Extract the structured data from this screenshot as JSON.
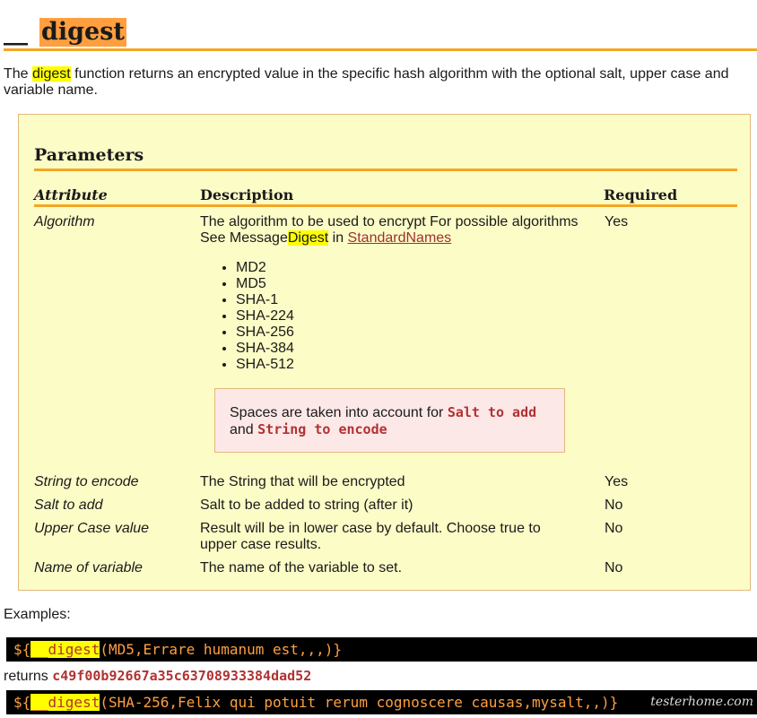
{
  "title": {
    "prefix": "__",
    "name": "digest"
  },
  "intro": {
    "before": "The ",
    "highlight": "digest",
    "after": " function returns an encrypted value in the specific hash algorithm with the optional salt, upper case and variable name."
  },
  "parameters": {
    "heading": "Parameters",
    "columns": {
      "attribute": "Attribute",
      "description": "Description",
      "required": "Required"
    },
    "rows": [
      {
        "attribute": "Algorithm",
        "desc_line1": "The algorithm to be used to encrypt For possible algorithms",
        "desc_line2_before": "See Message",
        "desc_line2_highlight": "Digest",
        "desc_line2_mid": " in ",
        "desc_link": "StandardNames",
        "algorithms": [
          "MD2",
          "MD5",
          "SHA-1",
          "SHA-224",
          "SHA-256",
          "SHA-384",
          "SHA-512"
        ],
        "note": {
          "before": "Spaces are taken into account for ",
          "code1": "Salt to add",
          "mid": "and ",
          "code2": "String to encode"
        },
        "required": "Yes"
      },
      {
        "attribute": "String to encode",
        "description": "The String that will be encrypted",
        "required": "Yes"
      },
      {
        "attribute": "Salt to add",
        "description": "Salt to be added to string (after it)",
        "required": "No"
      },
      {
        "attribute": "Upper Case value",
        "description_line1": "Result will be in lower case by default. Choose true to",
        "description_line2": "upper case results.",
        "required": "No"
      },
      {
        "attribute": "Name of variable",
        "description": "The name of the variable to set.",
        "required": "No"
      }
    ]
  },
  "examples": {
    "label": "Examples:",
    "example1": {
      "prefix": "${",
      "fn": "__digest",
      "args": "(MD5,Errare humanum est,,,)}"
    },
    "returns_label": "returns ",
    "returns_value": "c49f00b92667a35c63708933384dad52",
    "example2": {
      "prefix": "${",
      "fn": "__digest",
      "args": "(SHA-256,Felix qui potuit rerum cognoscere causas,mysalt,,)}"
    }
  },
  "watermark": "testerhome.com"
}
